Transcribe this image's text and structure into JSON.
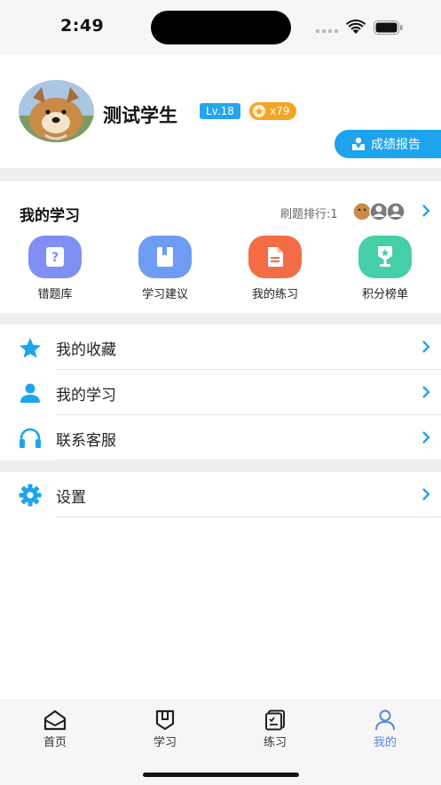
{
  "status_bar": {
    "time": "2:49"
  },
  "profile": {
    "name": "测试学生",
    "level": "Lv.18",
    "coins": "x79",
    "report_button": "成绩报告"
  },
  "study": {
    "title": "我的学习",
    "rank_label": "刷题排行:1",
    "items": [
      {
        "label": "错题库",
        "icon": "question-icon",
        "color": "#7f8ff3"
      },
      {
        "label": "学习建议",
        "icon": "book-icon",
        "color": "#6f9cf3"
      },
      {
        "label": "我的练习",
        "icon": "document-icon",
        "color": "#f36c45"
      },
      {
        "label": "积分榜单",
        "icon": "medal-icon",
        "color": "#45cfa9"
      }
    ]
  },
  "menu": [
    {
      "label": "我的收藏",
      "icon": "star-icon"
    },
    {
      "label": "我的学习",
      "icon": "person-icon"
    },
    {
      "label": "联系客服",
      "icon": "headset-icon"
    },
    {
      "label": "设置",
      "icon": "gear-icon"
    }
  ],
  "tabbar": {
    "tabs": [
      {
        "label": "首页",
        "icon": "home-icon"
      },
      {
        "label": "学习",
        "icon": "study-icon"
      },
      {
        "label": "练习",
        "icon": "practice-icon"
      },
      {
        "label": "我的",
        "icon": "profile-icon",
        "active": true
      }
    ]
  },
  "colors": {
    "accent": "#1ea4ee",
    "tab_active": "#5a86d6",
    "level_badge": "#23a6ee",
    "coin_badge": "#f5a524"
  }
}
